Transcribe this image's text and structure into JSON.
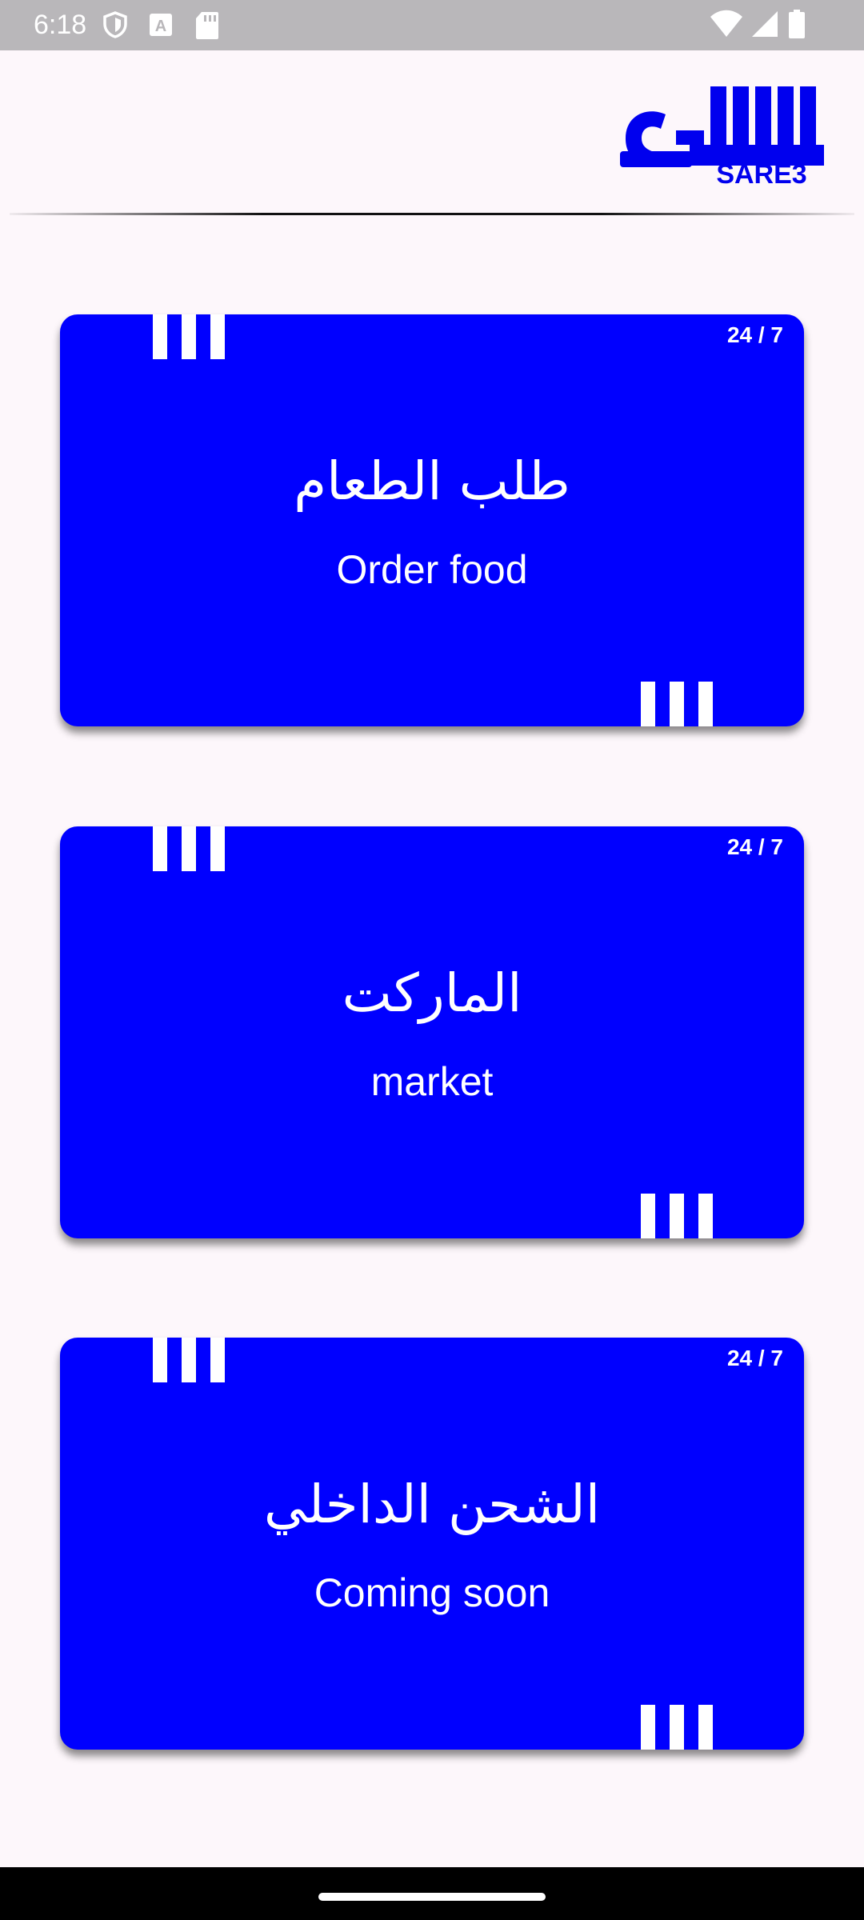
{
  "status_bar": {
    "time": "6:18",
    "icons": [
      "shield-icon",
      "font-icon",
      "sd-card-icon",
      "wifi-icon",
      "signal-icon",
      "battery-icon"
    ]
  },
  "header": {
    "logo_text": "SARE3"
  },
  "colors": {
    "card_background": "#0000ff",
    "page_background": "#fdf7fb",
    "logo_color": "#0000ee"
  },
  "cards": [
    {
      "hours": "24 / 7",
      "title_ar": "طلب الطعام",
      "subtitle": "Order food"
    },
    {
      "hours": "24 / 7",
      "title_ar": "الماركت",
      "subtitle": "market"
    },
    {
      "hours": "24 / 7",
      "title_ar": "الشحن الداخلي",
      "subtitle": "Coming soon"
    }
  ]
}
